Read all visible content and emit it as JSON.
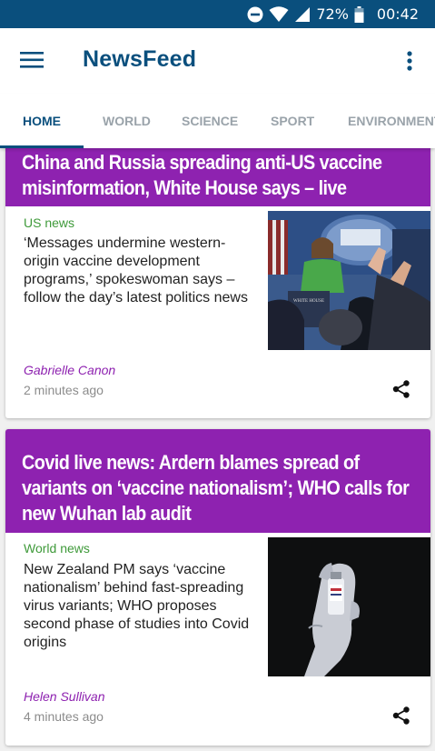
{
  "status_bar": {
    "battery": "72%",
    "time": "00:42",
    "icons": [
      "do-not-disturb-icon",
      "wifi-icon",
      "signal-icon",
      "battery-icon"
    ]
  },
  "app_bar": {
    "title": "NewsFeed",
    "menu_icon": "hamburger-menu-icon",
    "more_icon": "more-vert-icon"
  },
  "tabs": [
    {
      "label": "HOME",
      "active": true
    },
    {
      "label": "WORLD",
      "active": false
    },
    {
      "label": "SCIENCE",
      "active": false
    },
    {
      "label": "SPORT",
      "active": false
    },
    {
      "label": "ENVIRONMENT",
      "active": false
    }
  ],
  "articles": [
    {
      "headline": "China and Russia spreading anti-US vaccine misinformation, White House says – live",
      "section": "US news",
      "summary": "‘Messages undermine western-origin vaccine development programs,’ spokeswoman says – follow the day’s latest politics news",
      "author": "Gabrielle Canon",
      "time": "2 minutes ago",
      "image_sign_text": "WHITE HOUSE"
    },
    {
      "headline": "Covid live news: Ardern blames spread of variants on ‘vaccine nationalism’; WHO calls for new Wuhan lab audit",
      "section": "World news",
      "summary": "New Zealand PM says ‘vaccine nationalism’ behind fast-spreading virus variants; WHO proposes second phase of studies into Covid origins",
      "author": "Helen Sullivan",
      "time": "4 minutes ago"
    }
  ],
  "colors": {
    "status_bar": "#0a4f7d",
    "brand": "#0a4f7d",
    "headline_bg": "#8e22b0",
    "section_green": "#3f9a3a",
    "author_purple": "#8e22b0"
  }
}
